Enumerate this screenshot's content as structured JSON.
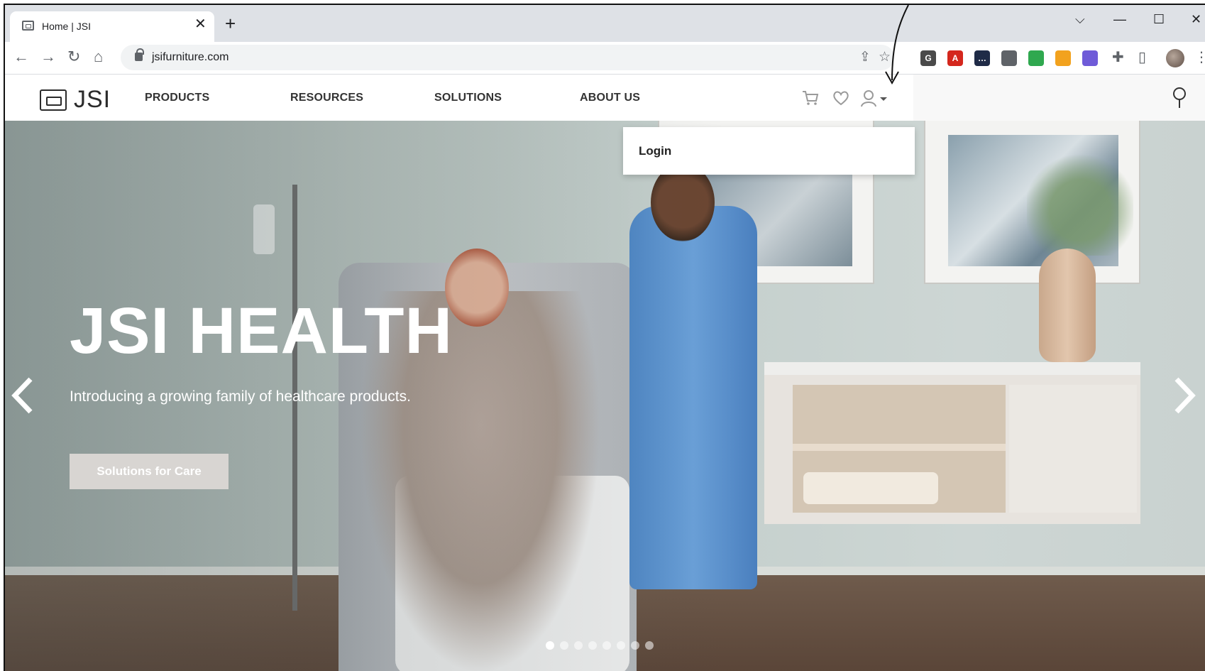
{
  "browser": {
    "tab_title": "Home | JSI",
    "tab_close": "✕",
    "new_tab": "+",
    "url": "jsifurniture.com",
    "window_controls": {
      "tab_search": "⌵",
      "minimize": "—",
      "maximize": "☐",
      "close": "✕"
    },
    "nav": {
      "back": "←",
      "forward": "→",
      "reload": "↻",
      "home": "⌂"
    },
    "omnibox_icons": {
      "share": "⇪",
      "bookmark": "☆"
    },
    "extensions": [
      {
        "name": "extension-1",
        "color": "#4a4a4a",
        "glyph": "G"
      },
      {
        "name": "acrobat",
        "color": "#d4271d",
        "glyph": "A"
      },
      {
        "name": "extension-3",
        "color": "#1f2b47",
        "glyph": "…"
      },
      {
        "name": "camera",
        "color": "#5f6368",
        "glyph": ""
      },
      {
        "name": "extension-5",
        "color": "#2fa84f",
        "glyph": ""
      },
      {
        "name": "extension-6",
        "color": "#f2a21e",
        "glyph": ""
      },
      {
        "name": "extension-7",
        "color": "#6f5bd8",
        "glyph": ""
      }
    ]
  },
  "site": {
    "logo_text": "JSI",
    "nav": [
      {
        "label": "PRODUCTS"
      },
      {
        "label": "RESOURCES"
      },
      {
        "label": "SOLUTIONS"
      },
      {
        "label": "ABOUT US"
      }
    ],
    "account_menu": {
      "login_label": "Login"
    }
  },
  "hero": {
    "title": "JSI HEALTH",
    "subtitle": "Introducing a growing family of healthcare products.",
    "cta_label": "Solutions for Care",
    "slide_count": 8,
    "active_slide": 1
  },
  "colors": {
    "nav_text": "#333333",
    "cta_bg": "#d8d5d2",
    "chrome_bg": "#dee1e6"
  }
}
